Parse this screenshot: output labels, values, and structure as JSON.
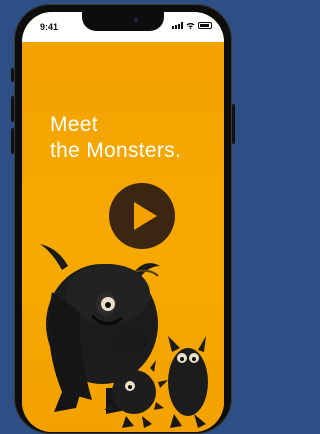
{
  "status_bar": {
    "time": "9:41"
  },
  "hero": {
    "line1": "Meet",
    "line2": "the Monsters."
  },
  "colors": {
    "background": "#2d4f86",
    "screen": "#f5a300",
    "play_button": "#3a2611",
    "monster": "#1a1a1a"
  },
  "icons": {
    "play": "play-icon",
    "signal": "signal-icon",
    "wifi": "wifi-icon",
    "battery": "battery-icon"
  }
}
